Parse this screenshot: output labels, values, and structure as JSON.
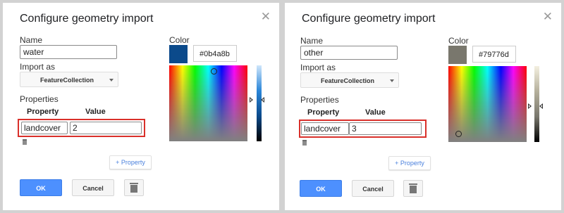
{
  "dialogs": [
    {
      "title": "Configure geometry import",
      "close_icon": "close-icon",
      "name_label": "Name",
      "name_value": "water",
      "import_as_label": "Import as",
      "import_as_value": "FeatureCollection",
      "properties_label": "Properties",
      "property_header": "Property",
      "value_header": "Value",
      "property_key": "landcover",
      "property_value": "2",
      "add_property_label": "+ Property",
      "ok_label": "OK",
      "cancel_label": "Cancel",
      "color_label": "Color",
      "color_hex": "#0b4a8b",
      "swatch_color": "#0b4a8b",
      "slider_colors": [
        "#cfe6fb",
        "#2b86d9",
        "#0b4a8b",
        "#000000"
      ]
    },
    {
      "title": "Configure geometry import",
      "close_icon": "close-icon",
      "name_label": "Name",
      "name_value": "other",
      "import_as_label": "Import as",
      "import_as_value": "FeatureCollection",
      "properties_label": "Properties",
      "property_header": "Property",
      "value_header": "Value",
      "property_key": "landcover",
      "property_value": "3",
      "add_property_label": "+ Property",
      "ok_label": "OK",
      "cancel_label": "Cancel",
      "color_label": "Color",
      "color_hex": "#79776d",
      "swatch_color": "#79776d",
      "slider_colors": [
        "#f4f0e0",
        "#b5b09c",
        "#79776d",
        "#000000"
      ]
    }
  ]
}
